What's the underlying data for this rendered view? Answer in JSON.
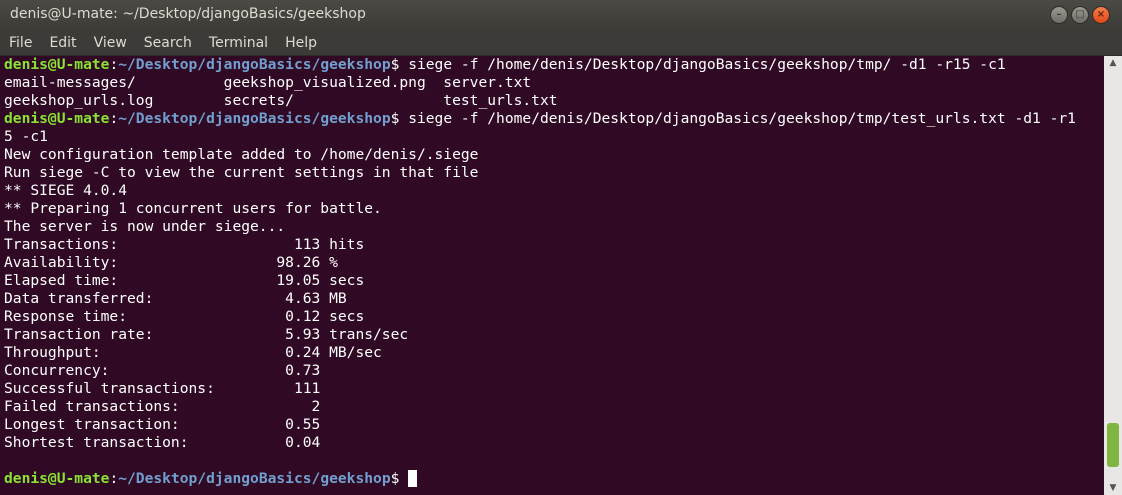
{
  "window": {
    "title": "denis@U-mate: ~/Desktop/djangoBasics/geekshop",
    "buttons": {
      "minimize": "–",
      "maximize": "□",
      "close": "×"
    }
  },
  "menu": [
    "File",
    "Edit",
    "View",
    "Search",
    "Terminal",
    "Help"
  ],
  "prompt": {
    "user": "denis@U-mate",
    "sep": ":",
    "path": "~/Desktop/djangoBasics/geekshop",
    "symbol": "$"
  },
  "terminal": {
    "cmd1": " siege -f /home/denis/Desktop/djangoBasics/geekshop/tmp/ -d1 -r15 -c1",
    "out1": "email-messages/          geekshop_visualized.png  server.txt",
    "out2": "geekshop_urls.log        secrets/                 test_urls.txt",
    "cmd2": " siege -f /home/denis/Desktop/djangoBasics/geekshop/tmp/test_urls.txt -d1 -r1",
    "cmd2_wrap": "5 -c1",
    "lines": [
      "New configuration template added to /home/denis/.siege",
      "Run siege -C to view the current settings in that file",
      "** SIEGE 4.0.4",
      "** Preparing 1 concurrent users for battle.",
      "The server is now under siege...",
      "Transactions:                    113 hits",
      "Availability:                  98.26 %",
      "Elapsed time:                  19.05 secs",
      "Data transferred:               4.63 MB",
      "Response time:                  0.12 secs",
      "Transaction rate:               5.93 trans/sec",
      "Throughput:                     0.24 MB/sec",
      "Concurrency:                    0.73",
      "Successful transactions:         111",
      "Failed transactions:               2",
      "Longest transaction:            0.55",
      "Shortest transaction:           0.04",
      ""
    ]
  },
  "scrollbar": {
    "up": "▲",
    "down": "▼"
  }
}
